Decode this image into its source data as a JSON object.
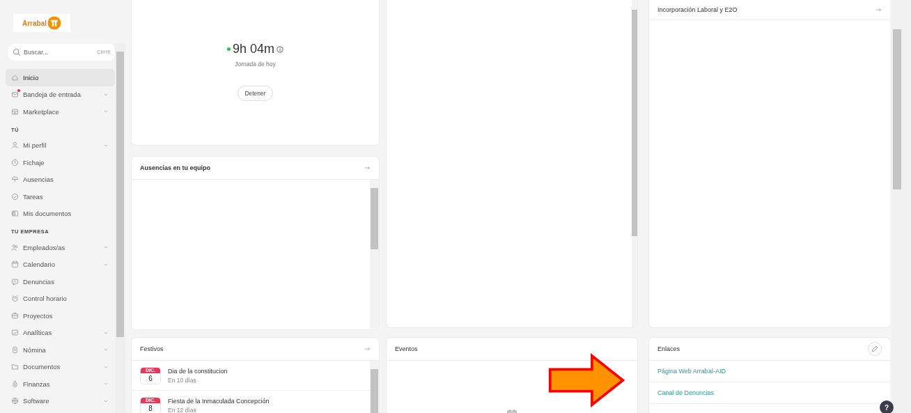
{
  "logo": {
    "text": "Arrabal"
  },
  "search": {
    "placeholder": "Buscar...",
    "shortcut": "Ctrl+K"
  },
  "sidebar": {
    "sections": [
      {
        "items": [
          {
            "label": "Inicio",
            "selected": true,
            "expandable": false,
            "notification": false
          },
          {
            "label": "Bandeja de entrada",
            "selected": false,
            "expandable": true,
            "notification": true
          },
          {
            "label": "Marketplace",
            "selected": false,
            "expandable": true,
            "notification": false
          }
        ]
      },
      {
        "title": "TÚ",
        "items": [
          {
            "label": "Mi perfil",
            "selected": false,
            "expandable": true,
            "notification": false
          },
          {
            "label": "Fichaje",
            "selected": false,
            "expandable": false,
            "notification": false
          },
          {
            "label": "Ausencias",
            "selected": false,
            "expandable": false,
            "notification": false
          },
          {
            "label": "Tareas",
            "selected": false,
            "expandable": false,
            "notification": false
          },
          {
            "label": "Mis documentos",
            "selected": false,
            "expandable": false,
            "notification": false
          }
        ]
      },
      {
        "title": "TU EMPRESA",
        "items": [
          {
            "label": "Empleados/as",
            "selected": false,
            "expandable": true,
            "notification": false
          },
          {
            "label": "Calendario",
            "selected": false,
            "expandable": true,
            "notification": false
          },
          {
            "label": "Denuncias",
            "selected": false,
            "expandable": false,
            "notification": false
          },
          {
            "label": "Control horario",
            "selected": false,
            "expandable": false,
            "notification": false
          },
          {
            "label": "Proyectos",
            "selected": false,
            "expandable": false,
            "notification": false
          },
          {
            "label": "Analíticas",
            "selected": false,
            "expandable": true,
            "notification": false
          },
          {
            "label": "Nómina",
            "selected": false,
            "expandable": true,
            "notification": false
          },
          {
            "label": "Documentos",
            "selected": false,
            "expandable": true,
            "notification": false
          },
          {
            "label": "Finanzas",
            "selected": false,
            "expandable": true,
            "notification": false
          },
          {
            "label": "Software",
            "selected": false,
            "expandable": true,
            "notification": false
          }
        ]
      }
    ]
  },
  "timer": {
    "value": "9h 04m",
    "running": true,
    "caption": "Jornada de hoy",
    "button": "Detener"
  },
  "absences": {
    "title": "Ausencias en tu equipo"
  },
  "holidays": {
    "title": "Festivos",
    "items": [
      {
        "month": "DIC.",
        "day": "6",
        "name": "Dia de la constitucion",
        "when": "En 10 días"
      },
      {
        "month": "DIC.",
        "day": "8",
        "name": "Fiesta de la Inmaculada Concepción",
        "when": "En 12 días"
      }
    ]
  },
  "events": {
    "title": "Eventos"
  },
  "onboarding": {
    "title": "Incorporación Laboral y E2O"
  },
  "links": {
    "title": "Enlaces",
    "items": [
      "Página Web Arrabal-AID",
      "Canal de Denuncias"
    ]
  },
  "help": {
    "label": "?"
  }
}
